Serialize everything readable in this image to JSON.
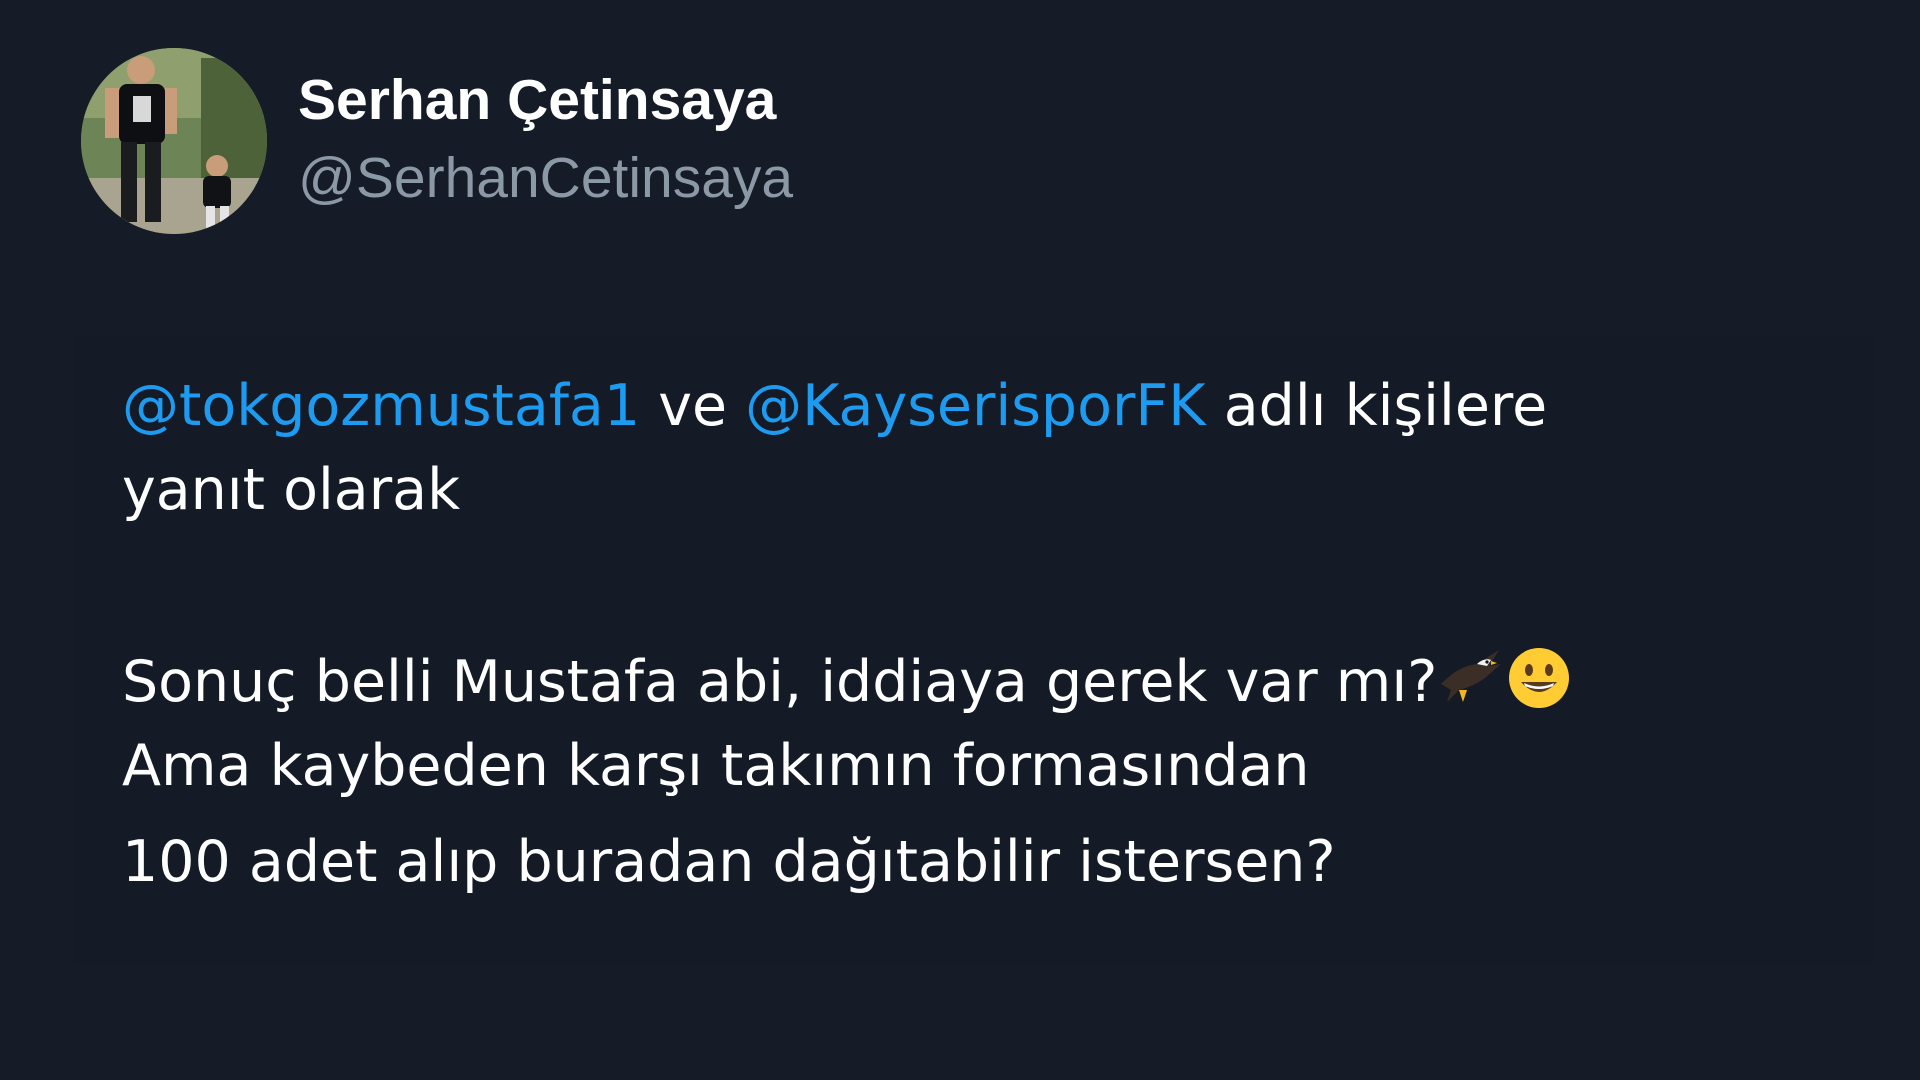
{
  "author": {
    "display_name": "Serhan Çetinsaya",
    "handle": "@SerhanCetinsaya"
  },
  "reply_context": {
    "mention_1": "@tokgozmustafa1",
    "connector": "ve",
    "mention_2": "@KayserisporFK",
    "suffix_line1": "adlı kişilere",
    "suffix_line2": "yanıt olarak"
  },
  "tweet": {
    "line1": "Sonuç belli Mustafa abi, iddiaya gerek var mı?",
    "line2": "Ama kaybeden karşı takımın formasından",
    "line3": "100 adet alıp buradan dağıtabilir istersen?",
    "emojis": [
      "eagle-icon",
      "grinning-face-icon"
    ]
  },
  "colors": {
    "background": "#151c28",
    "mention": "#1d9bf0",
    "handle": "#8b98a5",
    "text": "#ffffff"
  }
}
